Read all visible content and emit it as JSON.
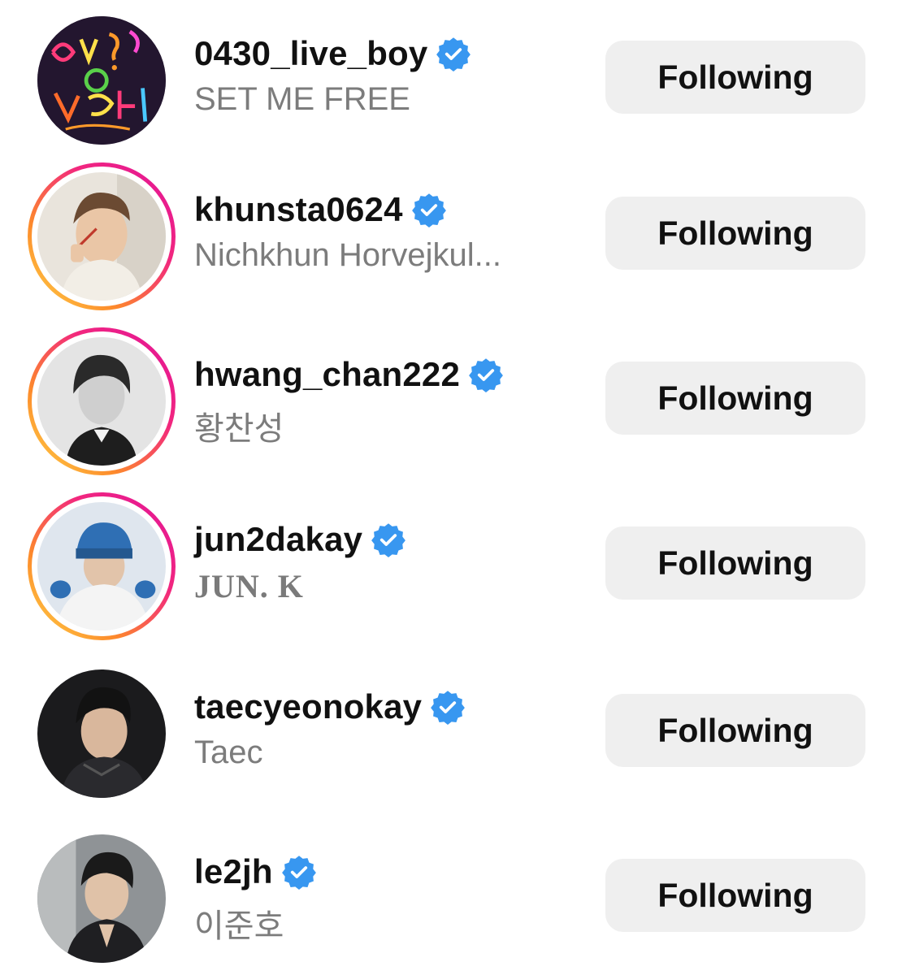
{
  "following_list": [
    {
      "username": "0430_live_boy",
      "subtitle": "SET ME FREE",
      "verified": true,
      "has_story": false,
      "button_label": "Following",
      "avatar_icon": "neon-sign-avatar"
    },
    {
      "username": "khunsta0624",
      "subtitle": "Nichkhun Horvejkul...",
      "verified": true,
      "has_story": true,
      "button_label": "Following",
      "avatar_icon": "profile-photo-avatar"
    },
    {
      "username": "hwang_chan222",
      "subtitle": "황찬성",
      "verified": true,
      "has_story": true,
      "button_label": "Following",
      "avatar_icon": "profile-photo-avatar"
    },
    {
      "username": "jun2dakay",
      "subtitle": "JUN. K",
      "verified": true,
      "has_story": true,
      "button_label": "Following",
      "avatar_icon": "profile-photo-avatar"
    },
    {
      "username": "taecyeonokay",
      "subtitle": "Taec",
      "verified": true,
      "has_story": false,
      "button_label": "Following",
      "avatar_icon": "profile-photo-avatar"
    },
    {
      "username": "le2jh",
      "subtitle": "이준호",
      "verified": true,
      "has_story": false,
      "button_label": "Following",
      "avatar_icon": "profile-photo-avatar"
    }
  ],
  "colors": {
    "verified_badge": "#3897f0",
    "button_bg": "#efefef",
    "username_text": "#111111",
    "subtitle_text": "#7c7c7c",
    "story_ring_start": "#feda4a",
    "story_ring_end": "#e1139b"
  }
}
